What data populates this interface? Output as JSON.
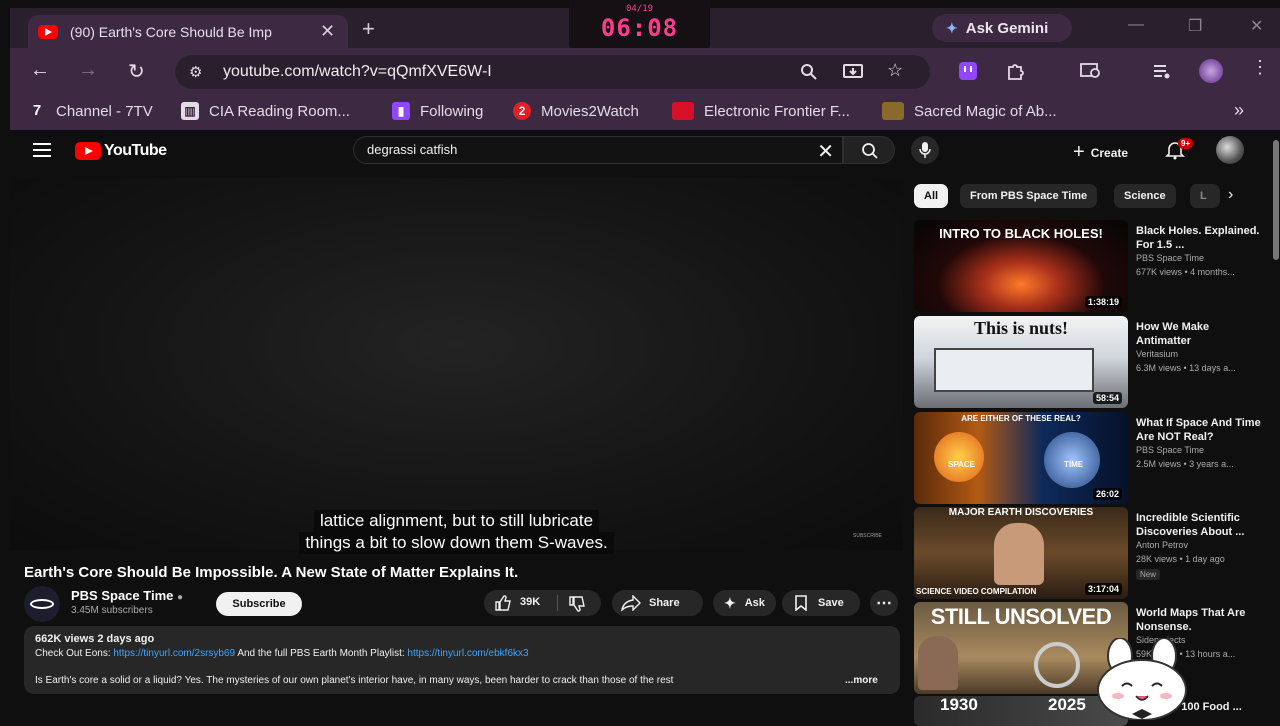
{
  "browser": {
    "tab_title": "(90) Earth's Core Should Be Imp",
    "clock_date": "04/19",
    "clock_time": "06:08",
    "gemini_label": "Ask Gemini",
    "url": "youtube.com/watch?v=qQmfXVE6W-I",
    "bookmarks": [
      {
        "label": "Channel - 7TV",
        "icon": "7tv-icon"
      },
      {
        "label": "CIA Reading Room...",
        "icon": "building-icon"
      },
      {
        "label": "Following",
        "icon": "twitch-icon"
      },
      {
        "label": "Movies2Watch",
        "icon": "movies2watch-icon"
      },
      {
        "label": "Electronic Frontier F...",
        "icon": "eff-icon"
      },
      {
        "label": "Sacred Magic of Ab...",
        "icon": "book-icon"
      }
    ]
  },
  "youtube": {
    "logo_text": "YouTube",
    "search_query": "degrassi catfish",
    "create_label": "Create",
    "notification_count": "9+",
    "caption_line1": "lattice alignment, but to still lubricate",
    "caption_line2": "things a bit to slow down them S-waves.",
    "watermark": "SUBSCRIBE",
    "video_title": "Earth's Core Should Be Impossible. A New State of Matter Explains It.",
    "channel_name": "PBS Space Time",
    "channel_subs": "3.45M subscribers",
    "subscribe_label": "Subscribe",
    "like_count": "39K",
    "share_label": "Share",
    "ask_label": "Ask",
    "save_label": "Save",
    "description": {
      "meta": "662K views  2 days ago",
      "line1_prefix": "Check Out Eons: ",
      "line1_link1": "https://tinyurl.com/2srsyb69",
      "line1_mid": " And the full PBS Earth Month Playlist: ",
      "line1_link2": "https://tinyurl.com/ebkf6kx3",
      "line2": "Is Earth's core a solid or a liquid? Yes. The mysteries of our own planet's interior have, in many ways, been harder to crack than those of the rest",
      "more_label": "...more"
    },
    "chips": [
      "All",
      "From PBS Space Time",
      "Science",
      "L"
    ],
    "recommendations": [
      {
        "title": "Black Holes. Explained. For 1.5 ...",
        "channel": "PBS Space Time",
        "stats": "677K views • 4 months...",
        "duration": "1:38:19",
        "thumb_text": "INTRO TO BLACK HOLES!",
        "badge": ""
      },
      {
        "title": "How We Make Antimatter",
        "channel": "Veritasium",
        "stats": "6.3M views • 13 days a...",
        "duration": "58:54",
        "thumb_text": "This is nuts!",
        "badge": ""
      },
      {
        "title": "What If Space And Time Are NOT Real?",
        "channel": "PBS Space Time",
        "stats": "2.5M views • 3 years a...",
        "duration": "26:02",
        "thumb_text": "ARE EITHER OF THESE REAL?",
        "badge": ""
      },
      {
        "title": "Incredible Scientific Discoveries About ...",
        "channel": "Anton Petrov",
        "stats": "28K views • 1 day ago",
        "duration": "3:17:04",
        "thumb_text": "MAJOR EARTH DISCOVERIES",
        "badge": "New"
      },
      {
        "title": "World Maps That Are Nonsense.",
        "channel": "Sideprojects",
        "stats": "59K views • 13 hours a...",
        "duration": "",
        "thumb_text": "STILL UNSOLVED",
        "badge": ""
      },
      {
        "title": "...n Eats 100 Food ...",
        "channel": "",
        "stats": "",
        "duration": "",
        "thumb_text": "1930",
        "badge": ""
      }
    ],
    "rec_thumb_extra": {
      "space": "SPACE",
      "time": "TIME",
      "compilation": "SCIENCE VIDEO COMPILATION",
      "year2": "2025"
    }
  },
  "colors": {
    "yt_red": "#ff0000",
    "link": "#3ea6ff",
    "clock": "#ff3b8a",
    "chrome_bg": "#3d2a42"
  }
}
